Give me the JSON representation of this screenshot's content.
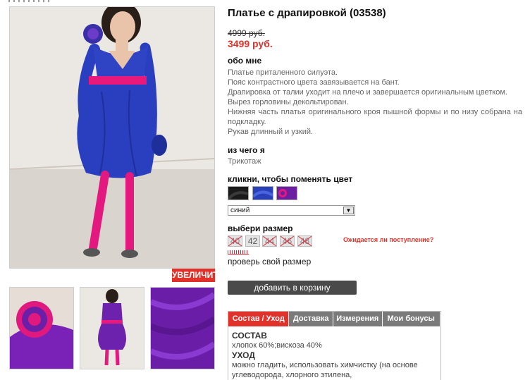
{
  "product": {
    "title": "Платье с драпировкой (03538)",
    "old_price": "4999 руб.",
    "new_price": "3499 руб."
  },
  "about": {
    "heading": "обо мне",
    "lines": [
      "Платье приталенного силуэта.",
      "Пояс контрастного цвета завязывается на бант.",
      "Драпировка от талии уходит на плечо и завершается оригинальным цветком.",
      "Вырез горловины декольтирован.",
      "Нижняя часть платья оригинального кроя пышной формы и по низу собрана на подкладку.",
      "Рукав длинный и узкий."
    ]
  },
  "material": {
    "heading": "из чего я",
    "value": "Трикотаж"
  },
  "color": {
    "heading": "кликни, чтобы поменять цвет",
    "selected": "синий",
    "swatches": [
      "black-icon",
      "blue-icon",
      "purple-icon"
    ],
    "swatch_colors": [
      "#1a1a1a",
      "#2940b8",
      "#6c1fa0"
    ]
  },
  "size": {
    "heading": "выбери размер",
    "options": [
      "40",
      "42",
      "44",
      "46",
      "48"
    ],
    "available": [
      false,
      true,
      false,
      false,
      false
    ],
    "expected_link": "Ожидается ли поступление?",
    "check_size": "проверь свой размер"
  },
  "gallery": {
    "enlarge_label": "УВЕЛИЧИТЬ"
  },
  "cart": {
    "add_label": "добавить в корзину"
  },
  "tabs": {
    "items": [
      "Состав / Уход",
      "Доставка",
      "Измерения",
      "Мои бонусы"
    ],
    "active": 0,
    "composition_heading": "СОСТАВ",
    "composition_value": "хлопок 60%;вискоза 40%",
    "care_heading": "УХОД",
    "care_value": "можно гладить, использовать химчистку (на основе углеводорода, хлорного этилена,"
  },
  "colors": {
    "accent_red": "#e0322a",
    "dark_button": "#4a4a4a",
    "dress_blue": "#2a3fbf",
    "belt_pink": "#e8197a"
  }
}
